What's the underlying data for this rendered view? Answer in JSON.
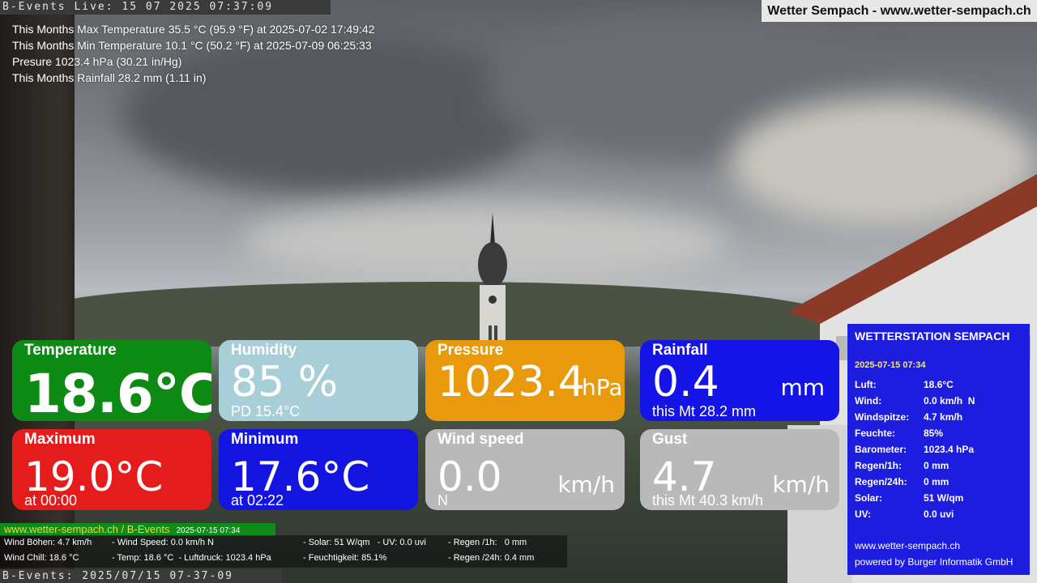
{
  "header": {
    "live_stamp": "B-Events Live: 15 07 2025 07:37:09",
    "site_title": "Wetter Sempach - www.wetter-sempach.ch"
  },
  "monthly_summary": [
    "This Months Max Temperature 35.5 °C (95.9 °F) at 2025-07-02 17:49:42",
    "This Months Min Temperature 10.1 °C (50.2 °F) at 2025-07-09 06:25:33",
    "Presure 1023.4 hPa (30.21 in/Hg)",
    "This Months Rainfall 28.2 mm (1.11 in)"
  ],
  "tiles": {
    "temperature": {
      "title": "Temperature",
      "value": "18.6°C",
      "color": "#0c8a14"
    },
    "humidity": {
      "title": "Humidity",
      "value": "85 %",
      "sub": "PD 15.4°C",
      "color": "#a8ced8"
    },
    "pressure": {
      "title": "Pressure",
      "value": "1023.4",
      "unit": "hPa",
      "color": "#e89a0c"
    },
    "rainfall": {
      "title": "Rainfall",
      "value": "0.4",
      "unit": "mm",
      "sub": "this Mt 28.2 mm",
      "color": "#1414e6"
    },
    "maximum": {
      "title": "Maximum",
      "value": "19.0°C",
      "sub": "at 00:00",
      "color": "#e41c1c"
    },
    "minimum": {
      "title": "Minimum",
      "value": "17.6°C",
      "sub": "at 02:22",
      "color": "#1414e0"
    },
    "wind_speed": {
      "title": "Wind speed",
      "value": "0.0",
      "unit": "km/h",
      "sub": "N",
      "color": "#b9b9b9"
    },
    "gust": {
      "title": "Gust",
      "value": "4.7",
      "unit": "km/h",
      "sub": "this Mt 40.3 km/h",
      "color": "#b9b9b9"
    }
  },
  "station_panel": {
    "title": "WETTERSTATION SEMPACH",
    "timestamp": "2025-07-15 07:34",
    "rows": [
      {
        "key": "Luft:",
        "value": "18.6°C"
      },
      {
        "key": "Wind:",
        "value": "0.0 km/h  N"
      },
      {
        "key": "Windspitze:",
        "value": "4.7 km/h"
      },
      {
        "key": "Feuchte:",
        "value": "85%"
      },
      {
        "key": "Barometer:",
        "value": "1023.4 hPa"
      },
      {
        "key": "Regen/1h:",
        "value": "0 mm"
      },
      {
        "key": "Regen/24h:",
        "value": "0 mm"
      },
      {
        "key": "Solar:",
        "value": "51 W/qm"
      },
      {
        "key": "UV:",
        "value": "0.0 uvi"
      }
    ],
    "footer_site": "www.wetter-sempach.ch",
    "footer_credit": "powered by Burger Informatik GmbH"
  },
  "ticker": {
    "site": "www.wetter-sempach.ch / B-Events",
    "date": "2025-07-15 07:34",
    "line1": [
      "Wind Böhen: 4.7 km/h",
      "- Wind Speed: 0.0 km/h N",
      "- Solar: 51 W/qm   - UV: 0.0 uvi",
      "- Regen /1h:   0 mm"
    ],
    "line2": [
      "Wind Chill: 18.6 °C",
      "- Temp: 18.6 °C  - Luftdruck: 1023.4 hPa",
      "- Feuchtigkeit: 85.1%",
      "- Regen /24h: 0.4 mm"
    ]
  },
  "footer": {
    "stamp": "B-Events: 2025/07/15 07-37-09"
  }
}
